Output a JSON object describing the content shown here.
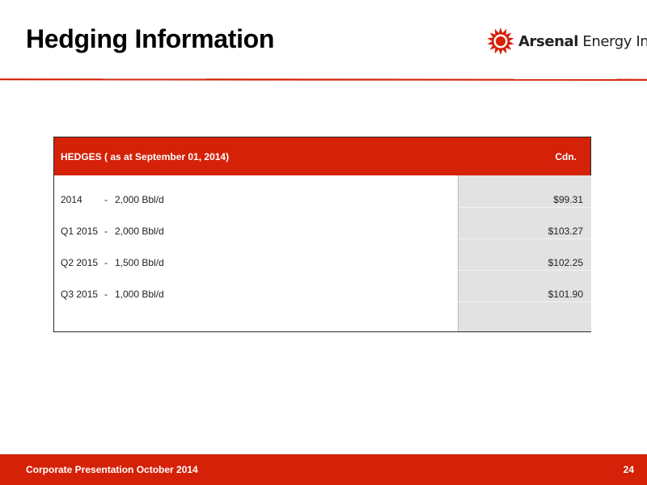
{
  "slide": {
    "title": "Hedging Information",
    "accent_color": "#d42108"
  },
  "logo": {
    "icon": "sunburst-logo-icon",
    "brand_bold": "Arsenal",
    "brand_rest": " Energy Inc."
  },
  "table": {
    "header_label": "HEDGES ( as at September 01, 2014)",
    "header_currency": "Cdn.",
    "rows": [
      {
        "period": "2014",
        "dash": "-",
        "volume": "2,000 Bbl/d",
        "price": "$99.31"
      },
      {
        "period": "Q1 2015",
        "dash": "-",
        "volume": "2,000 Bbl/d",
        "price": "$103.27"
      },
      {
        "period": "Q2 2015",
        "dash": "-",
        "volume": "1,500 Bbl/d",
        "price": "$102.25"
      },
      {
        "period": "Q3 2015",
        "dash": "-",
        "volume": "1,000 Bbl/d",
        "price": "$101.90"
      }
    ]
  },
  "footer": {
    "caption": "Corporate Presentation October 2014",
    "page_number": "24"
  }
}
